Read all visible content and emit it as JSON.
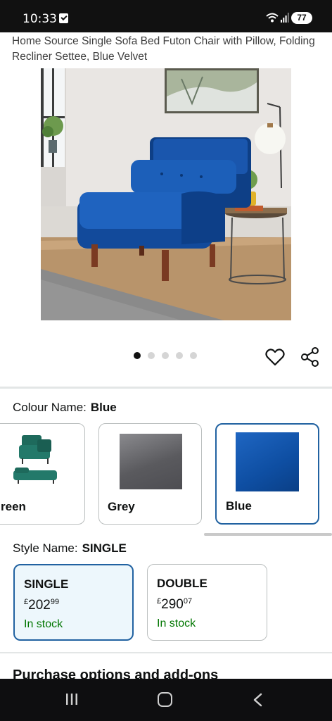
{
  "status_bar": {
    "time": "10:33",
    "battery": "77",
    "icons": [
      "notification-check-icon",
      "wifi-icon",
      "signal-icon",
      "battery-icon"
    ]
  },
  "product": {
    "title": "Home Source Single Sofa Bed Futon Chair with Pillow, Folding Recliner Settee, Blue Velvet",
    "image_carousel": {
      "total": 5,
      "active_index": 0
    },
    "actions": [
      "heart-icon",
      "share-icon"
    ]
  },
  "colour": {
    "label": "Colour Name:",
    "selected": "Blue",
    "options": [
      {
        "name": "Green",
        "visible_text": "reen",
        "selected": false
      },
      {
        "name": "Grey",
        "visible_text": "Grey",
        "selected": false
      },
      {
        "name": "Blue",
        "visible_text": "Blue",
        "selected": true
      }
    ],
    "colors": {
      "grey": "#6a6a6e",
      "blue": "#1556b0",
      "green": "#1e6a5c"
    }
  },
  "style": {
    "label": "Style Name:",
    "selected": "SINGLE",
    "options": [
      {
        "name": "SINGLE",
        "currency": "£",
        "price_whole": "202",
        "price_fraction": "99",
        "stock": "In stock",
        "selected": true
      },
      {
        "name": "DOUBLE",
        "currency": "£",
        "price_whole": "290",
        "price_fraction": "07",
        "stock": "In stock",
        "selected": false
      }
    ]
  },
  "purchase_heading": "Purchase options and add-ons",
  "theme": {
    "selected_border": "#2162a1",
    "selected_bg": "#edf7fc",
    "stock_color": "#007600"
  },
  "nav_bar": [
    "recent-apps-icon",
    "home-icon",
    "back-icon"
  ]
}
